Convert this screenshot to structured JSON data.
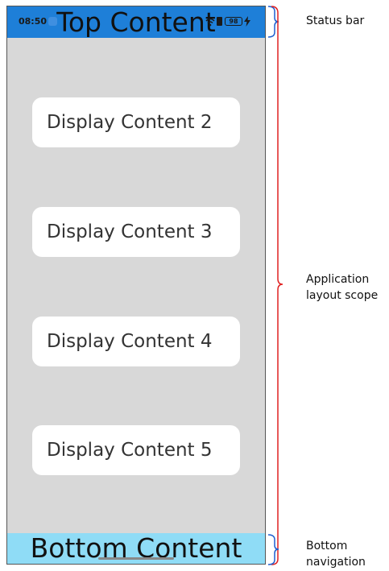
{
  "status_bar": {
    "time": "08:50",
    "battery_level": "98"
  },
  "top_bar": {
    "title": "Top Content",
    "color": "#1e7fd8"
  },
  "content": {
    "cards": [
      {
        "label": "Display Content 2"
      },
      {
        "label": "Display Content 3"
      },
      {
        "label": "Display Content 4"
      },
      {
        "label": "Display Content 5"
      }
    ],
    "background": "#d8d8d8"
  },
  "bottom_bar": {
    "title": "Bottom Content",
    "color": "#8fdcf6"
  },
  "annotations": {
    "status_bar": "Status bar",
    "app_layout": "Application layout scope",
    "bottom_nav": "Bottom navigation",
    "bracket_color_blue": "#1e5fd0",
    "bracket_color_red": "#e02020"
  }
}
